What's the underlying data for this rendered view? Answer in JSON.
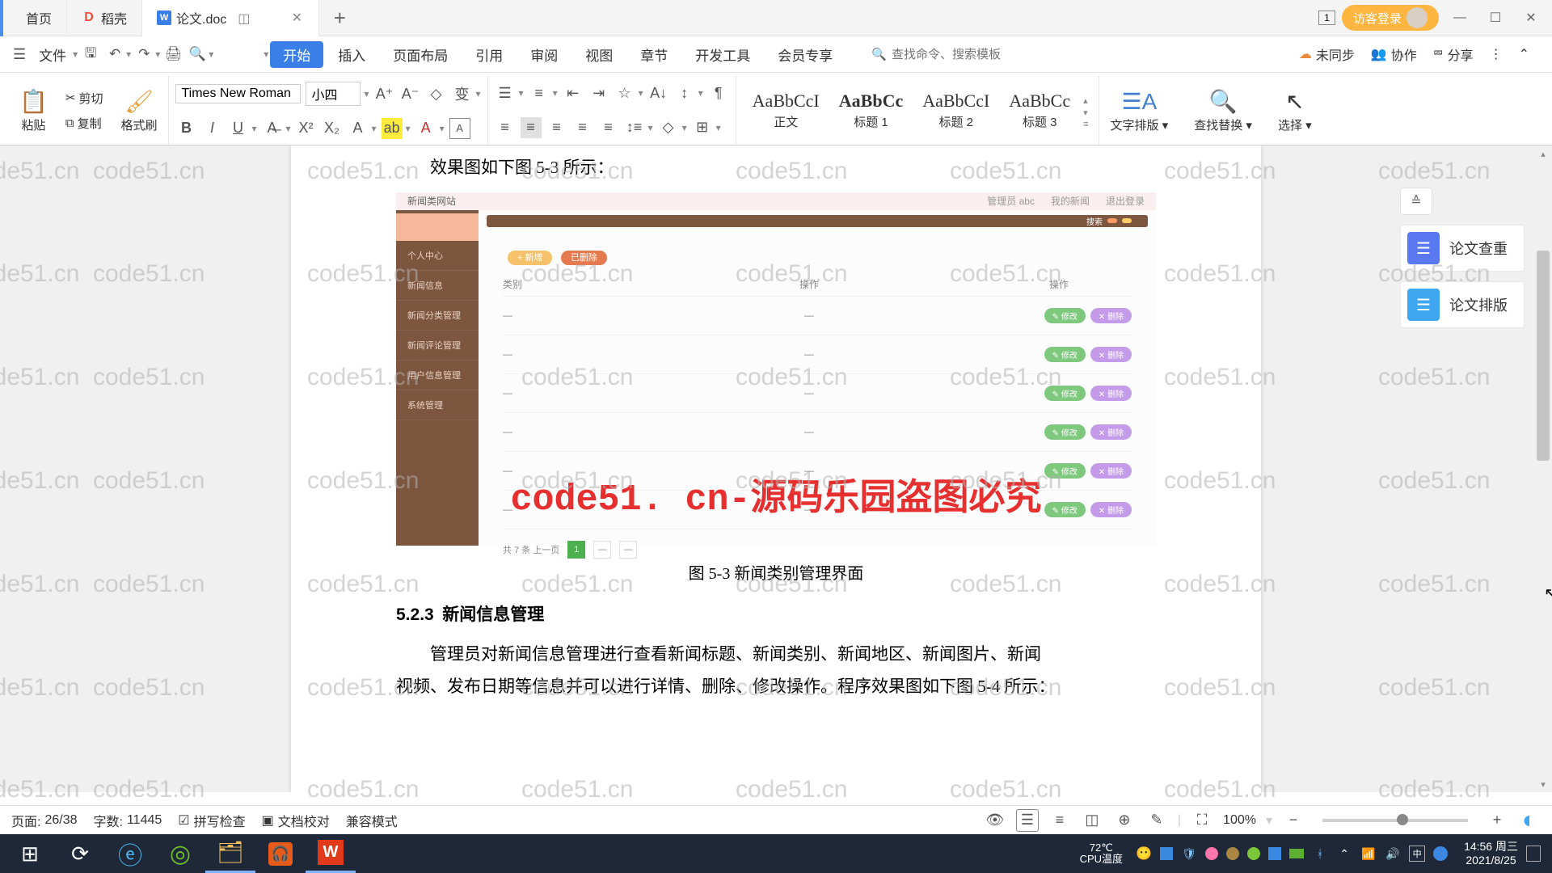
{
  "tabs": {
    "home": "首页",
    "t1": "稻壳",
    "t2": "论文.doc"
  },
  "titlebar": {
    "login": "访客登录",
    "window_id": "1"
  },
  "menubar": {
    "file": "文件",
    "tabs": [
      "开始",
      "插入",
      "页面布局",
      "引用",
      "审阅",
      "视图",
      "章节",
      "开发工具",
      "会员专享"
    ],
    "search_placeholder": "查找命令、搜索模板",
    "unsync": "未同步",
    "coop": "协作",
    "share": "分享"
  },
  "ribbon": {
    "paste": "粘贴",
    "cut": "剪切",
    "copy": "复制",
    "fmtbrush": "格式刷",
    "font": "Times New Roman",
    "size": "小四",
    "styles": [
      {
        "prev": "AaBbCcI",
        "name": "正文"
      },
      {
        "prev": "AaBbCc",
        "name": "标题 1"
      },
      {
        "prev": "AaBbCcI",
        "name": "标题 2"
      },
      {
        "prev": "AaBbCc",
        "name": "标题 3"
      }
    ],
    "layout": "文字排版",
    "findrep": "查找替换",
    "select": "选择"
  },
  "doc": {
    "line1": "效果图如下图 5-3 所示：",
    "caption": "图 5-3 新闻类别管理界面",
    "heading_no": "5.2.3",
    "heading": "新闻信息管理",
    "para2a": "管理员对新闻信息管理进行查看新闻标题、新闻类别、新闻地区、新闻图片、新闻",
    "para2b": "视频、发布日期等信息并可以进行详情、删除、修改操作。程序效果图如下图 5-4 所示："
  },
  "embed": {
    "title": "新闻类网站",
    "head_right": [
      "管理员 abc",
      "我的新闻",
      "退出登录"
    ],
    "side": [
      "个人中心",
      "新闻信息",
      "新闻分类管理",
      "新闻评论管理",
      "用户信息管理",
      "系统管理"
    ],
    "pill1": "+ 新增",
    "pill2": "已删除",
    "thead": [
      "类别",
      "操作",
      "操作"
    ],
    "actions": [
      "✎ 修改",
      "✕ 删除"
    ],
    "pager_total": "共 7 条 上一页"
  },
  "side_panel": {
    "check": "论文查重",
    "layout": "论文排版"
  },
  "status": {
    "page_label": "页面:",
    "page": "26/38",
    "words_label": "字数:",
    "words": "11445",
    "spell": "拼写检查",
    "proof": "文档校对",
    "compat": "兼容模式",
    "zoom": "100%"
  },
  "watermark_red": "code51. cn-源码乐园盗图必究",
  "watermark_grey": "code51.cn",
  "tray": {
    "cpu": "CPU温度",
    "temp": "72℃",
    "time": "14:56 周三",
    "date": "2021/8/25"
  }
}
